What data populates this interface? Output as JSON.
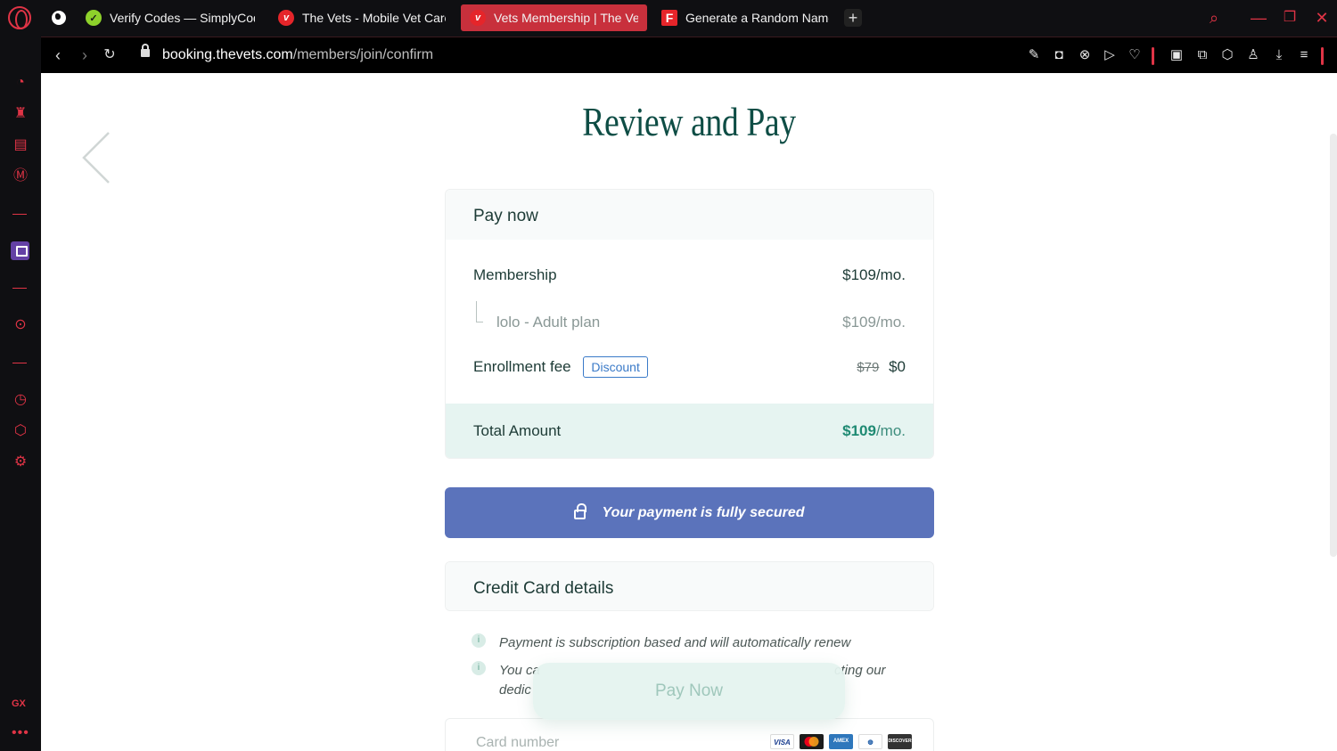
{
  "browser": {
    "tabs": [
      {
        "label": "Verify Codes — SimplyCodes",
        "favicon": "check-icon"
      },
      {
        "label": "The Vets - Mobile Vet Care",
        "favicon": "vets-icon"
      },
      {
        "label": "Vets Membership | The Vets",
        "favicon": "vets-icon",
        "active": true
      },
      {
        "label": "Generate a Random Name",
        "favicon": "f-icon"
      }
    ],
    "new_tab": "+",
    "url_host": "booking.thevets.com",
    "url_path": "/members/join/confirm",
    "sidebar_label": "GX",
    "more": "•••"
  },
  "page": {
    "title": "Review and Pay",
    "pay_now": {
      "header": "Pay now",
      "membership_label": "Membership",
      "membership_amount": "$109/mo.",
      "plan_label": "lolo - Adult plan",
      "plan_amount": "$109/mo.",
      "enrollment_label": "Enrollment fee",
      "discount_badge": "Discount",
      "enrollment_old": "$79",
      "enrollment_new": "$0",
      "total_label": "Total Amount",
      "total_value": "$109",
      "total_suffix": "/mo."
    },
    "secure_banner": "Your payment is fully secured",
    "credit_card": {
      "header": "Credit Card details",
      "info_1": "Payment is subscription based and will automatically renew",
      "info_2_start": "You ca",
      "info_2_end": "cting our",
      "info_2_line2": "dedic",
      "card_number_placeholder": "Card number",
      "card_brands": [
        "VISA",
        "MC",
        "AMEX",
        "DC",
        "DISCOVER"
      ]
    },
    "pay_now_button": "Pay Now"
  },
  "colors": {
    "accent_red": "#e03446",
    "brand_teal": "#0e4d45",
    "total_bg": "#e6f4f1",
    "secure_blue": "#5b73bb"
  }
}
